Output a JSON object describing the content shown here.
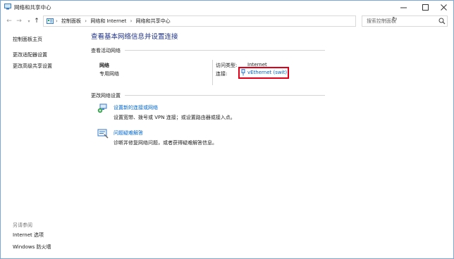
{
  "window": {
    "title": "网络和共享中心"
  },
  "address_bar": {
    "crumbs": [
      "控制面板",
      "网络和 Internet",
      "网络和共享中心"
    ],
    "separator": "›",
    "search_placeholder": "搜索控制面板"
  },
  "sidebar": {
    "items": [
      {
        "label": "控制面板主页"
      },
      {
        "label": "更改适配器设置"
      },
      {
        "label": "更改高级共享设置"
      }
    ],
    "see_also_header": "另请参阅",
    "see_also": [
      {
        "label": "Internet 选项"
      },
      {
        "label": "Windows 防火墙"
      }
    ]
  },
  "main": {
    "title": "查看基本网络信息并设置连接",
    "active_header": "查看活动网络",
    "network": {
      "name": "网络",
      "type": "专用网络",
      "access_label": "访问类型:",
      "access_value": "Internet",
      "connections_label": "连接:",
      "connection_name": "vEthernet (swit)"
    },
    "change_header": "更改网络设置",
    "tasks": [
      {
        "title": "设置新的连接或网络",
        "desc": "设置宽带、拨号或 VPN 连接；或设置路由器或接入点。",
        "icon": "new-connection-icon"
      },
      {
        "title": "问题疑难解答",
        "desc": "诊断并修复网络问题，或者获得疑难解答信息。",
        "icon": "troubleshoot-icon"
      }
    ]
  },
  "colors": {
    "title_blue": "#1e3287",
    "link_blue": "#0066cc",
    "highlight_red": "#e1001a"
  }
}
